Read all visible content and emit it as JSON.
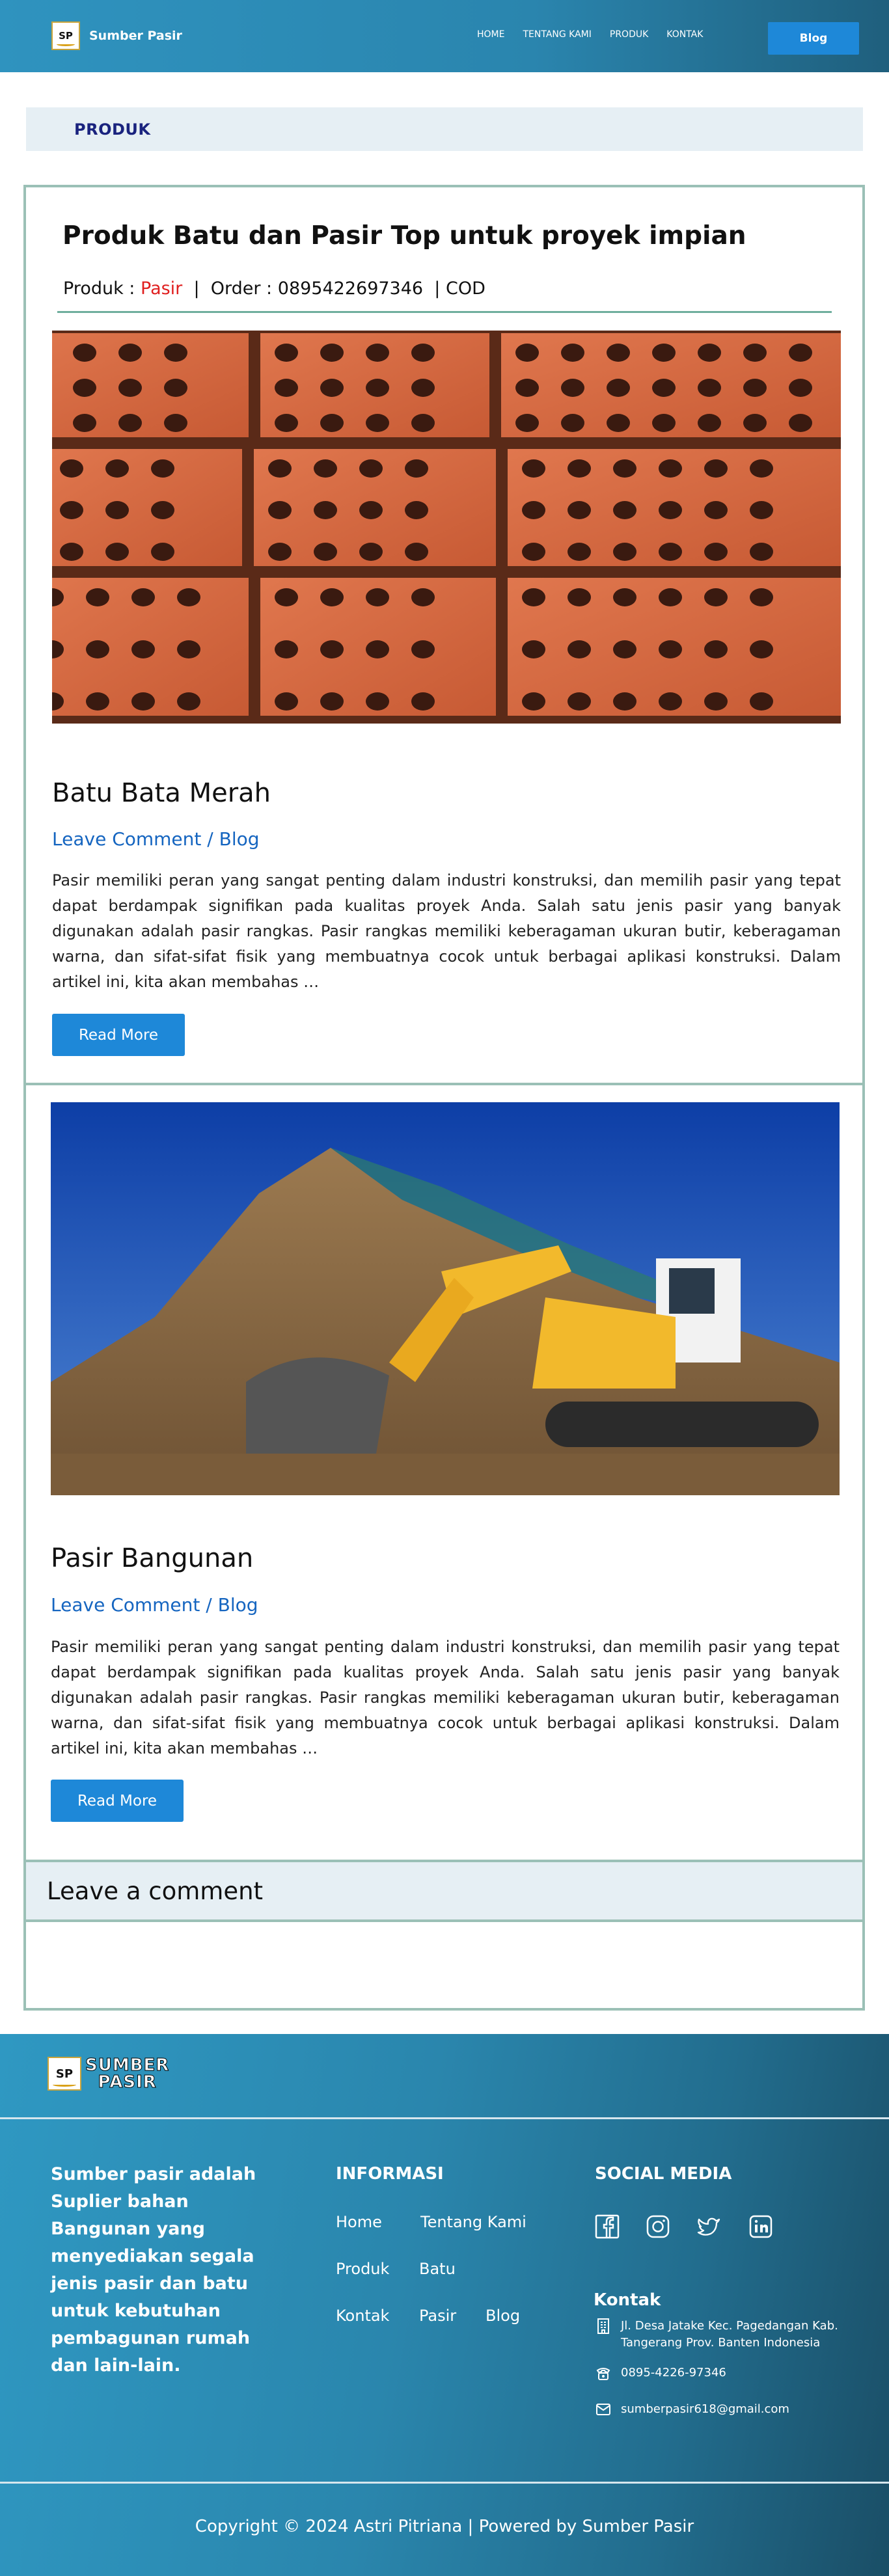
{
  "header": {
    "logo_mark": "SP",
    "brand": "Sumber Pasir",
    "nav": [
      "HOME",
      "TENTANG KAMI",
      "PRODUK",
      "KONTAK"
    ],
    "blog_button": "Blog"
  },
  "section_label": "PRODUK",
  "page": {
    "title": "Produk Batu dan Pasir Top untuk proyek impian",
    "meta_produk_label": "Produk :",
    "meta_produk_value": "Pasir",
    "meta_sep1": "|",
    "meta_order_label": "Order :",
    "meta_order_value": "0895422697346",
    "meta_sep2": "|",
    "meta_cod": "COD"
  },
  "posts": [
    {
      "title": "Batu Bata Merah",
      "meta": "Leave Comment / Blog",
      "excerpt": "Pasir memiliki peran yang sangat penting dalam industri konstruksi, dan memilih pasir yang tepat dapat berdampak signifikan pada kualitas proyek Anda. Salah satu jenis pasir yang banyak digunakan adalah pasir rangkas. Pasir rangkas memiliki keberagaman ukuran butir, keberagaman warna, dan sifat-sifat fisik yang membuatnya cocok untuk berbagai aplikasi konstruksi. Dalam artikel ini, kita akan membahas …",
      "button": "Read More"
    },
    {
      "title": "Pasir Bangunan",
      "meta": "Leave Comment / Blog",
      "excerpt": "Pasir memiliki peran yang sangat penting dalam industri konstruksi, dan memilih pasir yang tepat dapat berdampak signifikan pada kualitas proyek Anda. Salah satu jenis pasir yang banyak digunakan adalah pasir rangkas. Pasir rangkas memiliki keberagaman ukuran butir, keberagaman warna, dan sifat-sifat fisik yang membuatnya cocok untuk berbagai aplikasi konstruksi. Dalam artikel ini, kita akan membahas …",
      "button": "Read More"
    }
  ],
  "comment": {
    "heading": "Leave a comment"
  },
  "footer": {
    "logo_mark": "SP",
    "logo_line1": "SUMBER",
    "logo_line2": "PASIR",
    "about": "Sumber pasir adalah Suplier bahan Bangunan yang menyediakan segala jenis pasir dan batu untuk kebutuhan pembagunan rumah dan lain-lain.",
    "info_heading": "INFORMASI",
    "info_links": [
      "Home",
      "Tentang Kami",
      "Produk",
      "Batu",
      "Kontak",
      "Pasir",
      "Blog"
    ],
    "social_heading": "SOCIAL MEDIA",
    "social_icons": [
      "facebook-icon",
      "instagram-icon",
      "twitter-icon",
      "linkedin-icon"
    ],
    "kontak_heading": "Kontak",
    "address": "Jl. Desa Jatake Kec. Pagedangan Kab. Tangerang Prov. Banten Indonesia",
    "phone": "0895-4226-97346",
    "email": "sumberpasir618@gmail.com",
    "copyright": "Copyright © 2024 Astri Pitriana | Powered by Sumber Pasir"
  }
}
